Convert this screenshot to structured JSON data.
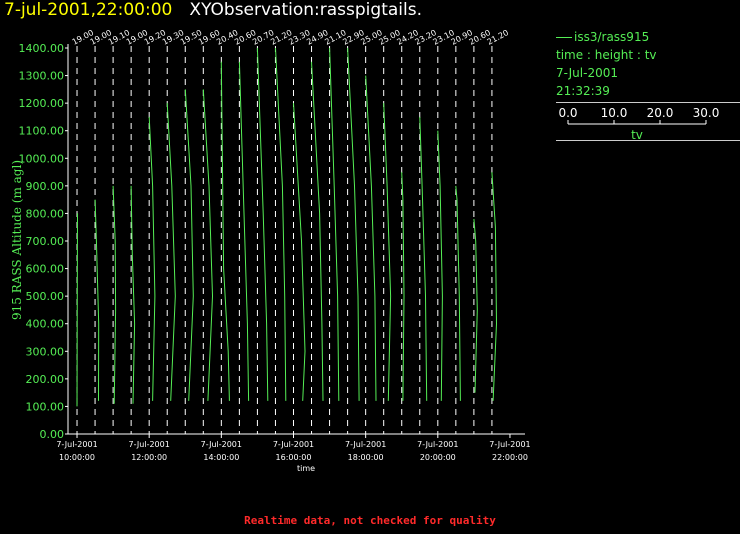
{
  "header": {
    "datetime": "7-jul-2001,22:00:00",
    "observation": "XYObservation:rasspigtails."
  },
  "legend": {
    "source": "iss3/rass915",
    "axes": "time : height : tv",
    "date": "7-Jul-2001",
    "time": "21:32:39",
    "scale_labels": [
      "0.0",
      "10.0",
      "20.0",
      "30.0"
    ],
    "scale_variable": "tv",
    "line_color": "#55ee55"
  },
  "footer": "Realtime data, not checked for quality",
  "chart_data": {
    "type": "line",
    "ylabel": "915 RASS Altitude (m agl)",
    "xlabel": "time",
    "ylim": [
      0,
      1400
    ],
    "yticks": [
      "0.00",
      "100.00",
      "200.00",
      "300.00",
      "400.00",
      "500.00",
      "600.00",
      "700.00",
      "800.00",
      "900.00",
      "1000.00",
      "1100.00",
      "1200.00",
      "1300.00",
      "1400.00"
    ],
    "xlim": [
      "09:45",
      "22:25"
    ],
    "xticks": [
      {
        "date": "7-Jul-2001",
        "time": "10:00:00"
      },
      {
        "date": "7-Jul-2001",
        "time": "12:00:00"
      },
      {
        "date": "7-Jul-2001",
        "time": "14:00:00"
      },
      {
        "date": "7-Jul-2001",
        "time": "16:00:00"
      },
      {
        "date": "7-Jul-2001",
        "time": "18:00:00"
      },
      {
        "date": "7-Jul-2001",
        "time": "20:00:00"
      },
      {
        "date": "7-Jul-2001",
        "time": "22:00:00"
      }
    ],
    "grid": false,
    "line_color": "#55ee55",
    "profiles": [
      {
        "time": "10:00",
        "label": "19.00",
        "tv": [
          [
            0,
            100
          ],
          [
            0.1,
            400
          ],
          [
            0.2,
            800
          ]
        ]
      },
      {
        "time": "10:30",
        "label": "19.00",
        "tv": [
          [
            1.5,
            120
          ],
          [
            1.6,
            400
          ],
          [
            0.6,
            700
          ],
          [
            0,
            850
          ]
        ]
      },
      {
        "time": "11:00",
        "label": "19.10",
        "tv": [
          [
            0.5,
            110
          ],
          [
            1.1,
            450
          ],
          [
            0.9,
            700
          ],
          [
            0,
            900
          ]
        ]
      },
      {
        "time": "11:30",
        "label": "19.00",
        "tv": [
          [
            0.8,
            110
          ],
          [
            1.5,
            400
          ],
          [
            0.5,
            650
          ],
          [
            0,
            900
          ]
        ]
      },
      {
        "time": "12:00",
        "label": "19.20",
        "tv": [
          [
            1.5,
            120
          ],
          [
            2.5,
            500
          ],
          [
            1.5,
            900
          ],
          [
            0,
            1150
          ]
        ]
      },
      {
        "time": "12:30",
        "label": "19.30",
        "tv": [
          [
            1.5,
            120
          ],
          [
            3.5,
            500
          ],
          [
            2.0,
            900
          ],
          [
            0,
            1200
          ]
        ]
      },
      {
        "time": "13:00",
        "label": "19.50",
        "tv": [
          [
            1.5,
            120
          ],
          [
            3.5,
            500
          ],
          [
            2.5,
            900
          ],
          [
            0,
            1250
          ]
        ]
      },
      {
        "time": "13:30",
        "label": "19.60",
        "tv": [
          [
            2.0,
            120
          ],
          [
            4.0,
            500
          ],
          [
            2.5,
            900
          ],
          [
            0,
            1250
          ]
        ]
      },
      {
        "time": "14:00",
        "label": "20.40",
        "tv": [
          [
            3.5,
            120
          ],
          [
            3.0,
            300
          ],
          [
            1.0,
            600
          ],
          [
            0,
            1350
          ]
        ]
      },
      {
        "time": "14:30",
        "label": "20.60",
        "tv": [
          [
            4.0,
            120
          ],
          [
            3.5,
            400
          ],
          [
            2.0,
            800
          ],
          [
            0,
            1350
          ]
        ]
      },
      {
        "time": "15:00",
        "label": "20.70",
        "tv": [
          [
            4.5,
            120
          ],
          [
            4.0,
            400
          ],
          [
            2.5,
            800
          ],
          [
            0,
            1400
          ]
        ]
      },
      {
        "time": "15:30",
        "label": "21.20",
        "tv": [
          [
            4.5,
            120
          ],
          [
            4.0,
            500
          ],
          [
            3.0,
            900
          ],
          [
            0,
            1400
          ]
        ]
      },
      {
        "time": "16:00",
        "label": "23.30",
        "tv": [
          [
            4.0,
            120
          ],
          [
            5.0,
            300
          ],
          [
            3.5,
            700
          ],
          [
            0,
            1200
          ]
        ]
      },
      {
        "time": "16:30",
        "label": "24.90",
        "tv": [
          [
            5.0,
            120
          ],
          [
            4.5,
            400
          ],
          [
            3.5,
            800
          ],
          [
            0,
            1350
          ]
        ]
      },
      {
        "time": "17:00",
        "label": "21.10",
        "tv": [
          [
            4.0,
            120
          ],
          [
            3.5,
            500
          ],
          [
            2.0,
            900
          ],
          [
            0,
            1400
          ]
        ]
      },
      {
        "time": "17:30",
        "label": "22.90",
        "tv": [
          [
            5.0,
            120
          ],
          [
            4.5,
            500
          ],
          [
            3.0,
            900
          ],
          [
            0,
            1400
          ]
        ]
      },
      {
        "time": "18:00",
        "label": "25.00",
        "tv": [
          [
            4.5,
            120
          ],
          [
            4.0,
            500
          ],
          [
            2.5,
            900
          ],
          [
            0,
            1300
          ]
        ]
      },
      {
        "time": "18:30",
        "label": "25.00",
        "tv": [
          [
            2.0,
            120
          ],
          [
            3.0,
            500
          ],
          [
            1.5,
            900
          ],
          [
            0,
            1200
          ]
        ]
      },
      {
        "time": "19:00",
        "label": "24.20",
        "tv": [
          [
            0.5,
            120
          ],
          [
            1.0,
            500
          ],
          [
            0.5,
            850
          ],
          [
            0,
            950
          ]
        ]
      },
      {
        "time": "19:30",
        "label": "23.20",
        "tv": [
          [
            3.0,
            120
          ],
          [
            2.5,
            500
          ],
          [
            1.0,
            900
          ],
          [
            0,
            1150
          ]
        ]
      },
      {
        "time": "20:00",
        "label": "23.10",
        "tv": [
          [
            1.5,
            120
          ],
          [
            2.0,
            500
          ],
          [
            1.0,
            900
          ],
          [
            0,
            1100
          ]
        ]
      },
      {
        "time": "20:30",
        "label": "20.90",
        "tv": [
          [
            2.0,
            120
          ],
          [
            1.5,
            500
          ],
          [
            0.5,
            850
          ],
          [
            0,
            900
          ]
        ]
      },
      {
        "time": "21:00",
        "label": "20.60",
        "tv": [
          [
            0.5,
            150
          ],
          [
            1.5,
            450
          ],
          [
            0.8,
            700
          ],
          [
            0,
            780
          ]
        ]
      },
      {
        "time": "21:30",
        "label": "21.20",
        "tv": [
          [
            0.5,
            120
          ],
          [
            2.0,
            400
          ],
          [
            1.5,
            750
          ],
          [
            0,
            950
          ]
        ]
      }
    ]
  }
}
